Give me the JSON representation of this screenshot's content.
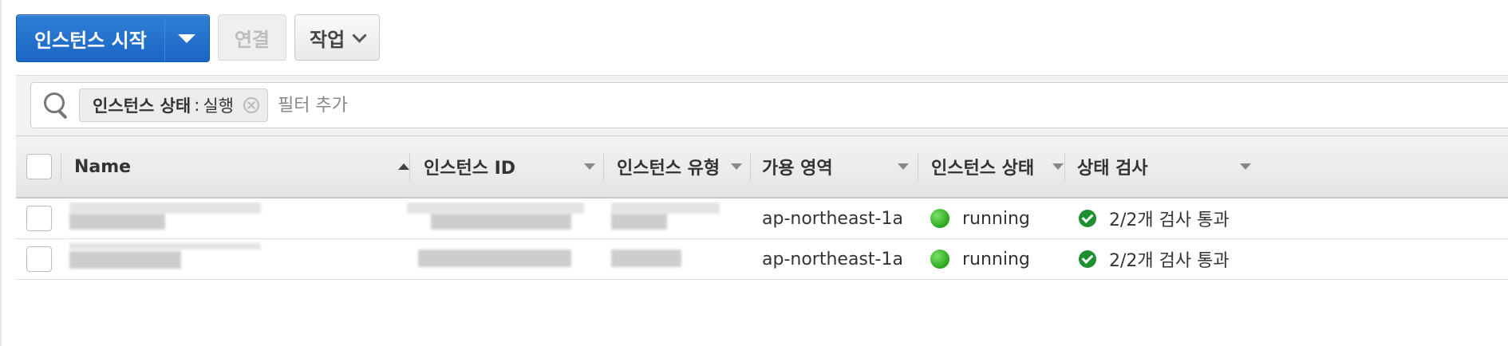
{
  "toolbar": {
    "launch_label": "인스턴스 시작",
    "connect_label": "연결",
    "actions_label": "작업"
  },
  "filter": {
    "token_key": "인스턴스 상태",
    "token_sep": ":",
    "token_value": "실행",
    "placeholder": "필터 추가"
  },
  "table": {
    "columns": [
      "Name",
      "인스턴스 ID",
      "인스턴스 유형",
      "가용 영역",
      "인스턴스 상태",
      "상태 검사"
    ],
    "rows": [
      {
        "availability_zone": "ap-northeast-1a",
        "state": "running",
        "status_check": "2/2개 검사 통과"
      },
      {
        "availability_zone": "ap-northeast-1a",
        "state": "running",
        "status_check": "2/2개 검사 통과"
      }
    ]
  },
  "colors": {
    "primary_button": "#1b66c4",
    "running": "#2aa51b",
    "check_passed": "#1e8f2e"
  },
  "icons": [
    "chevron-down-icon",
    "search-icon",
    "clear-filter-icon",
    "sort-asc-icon",
    "sort-icon",
    "running-status-icon",
    "check-passed-icon"
  ]
}
